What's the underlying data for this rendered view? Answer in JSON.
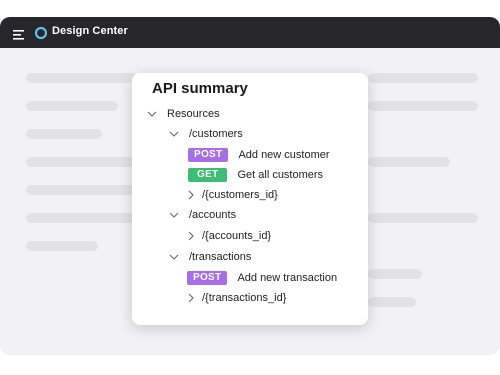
{
  "app": {
    "title": "Design Center",
    "icons": {
      "menu": "hamburger-menu-icon",
      "logo": "design-center-logo-icon"
    },
    "colors": {
      "topbar": "#26262b",
      "background": "#f2f2f4",
      "post": "#a86ee8",
      "get": "#3cbc74"
    }
  },
  "summary": {
    "title": "API summary",
    "root_label": "Resources",
    "customers": {
      "label": "/customers",
      "post_method": "POST",
      "post_label": "Add new customer",
      "get_method": "GET",
      "get_label": "Get all customers",
      "child_label": "/{customers_id}"
    },
    "accounts": {
      "label": "/accounts",
      "child_label": "/{accounts_id}"
    },
    "transactions": {
      "label": "/transactions",
      "post_method": "POST",
      "post_label": "Add new transaction",
      "child_label": "/{transactions_id}"
    }
  }
}
